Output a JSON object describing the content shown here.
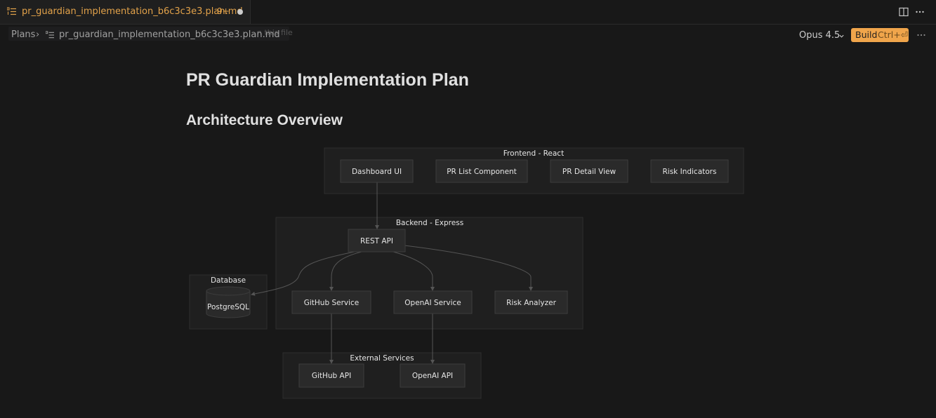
{
  "tab": {
    "title": "pr_guardian_implementation_b6c3c3e3.plan.md",
    "badge": "9+"
  },
  "breadcrumb": {
    "root": "Plans",
    "separator": "›",
    "file": "pr_guardian_implementation_b6c3c3e3.plan.md",
    "ghost_hint": "n this file"
  },
  "toolbar": {
    "model": "Opus 4.5",
    "build_label": "Build",
    "build_shortcut": "Ctrl+⏎"
  },
  "document": {
    "title": "PR Guardian Implementation Plan",
    "section": "Architecture Overview"
  },
  "diagram": {
    "clusters": {
      "frontend": "Frontend - React",
      "backend": "Backend - Express",
      "database": "Database",
      "external": "External Services"
    },
    "nodes": {
      "dashboard": "Dashboard UI",
      "pr_list": "PR List Component",
      "pr_detail": "PR Detail View",
      "risk_indicators": "Risk Indicators",
      "rest_api": "REST API",
      "github_service": "GitHub Service",
      "openai_service": "OpenAI Service",
      "risk_analyzer": "Risk Analyzer",
      "postgres": "PostgreSQL",
      "github_api": "GitHub API",
      "openai_api": "OpenAI API"
    }
  },
  "icons": {
    "tab": "list-ordered-icon",
    "split": "split-editor-icon",
    "more": "ellipsis-icon",
    "chevron": "chevron-down-icon"
  },
  "colors": {
    "accent": "#e2a24a",
    "build": "#f0a54b"
  }
}
